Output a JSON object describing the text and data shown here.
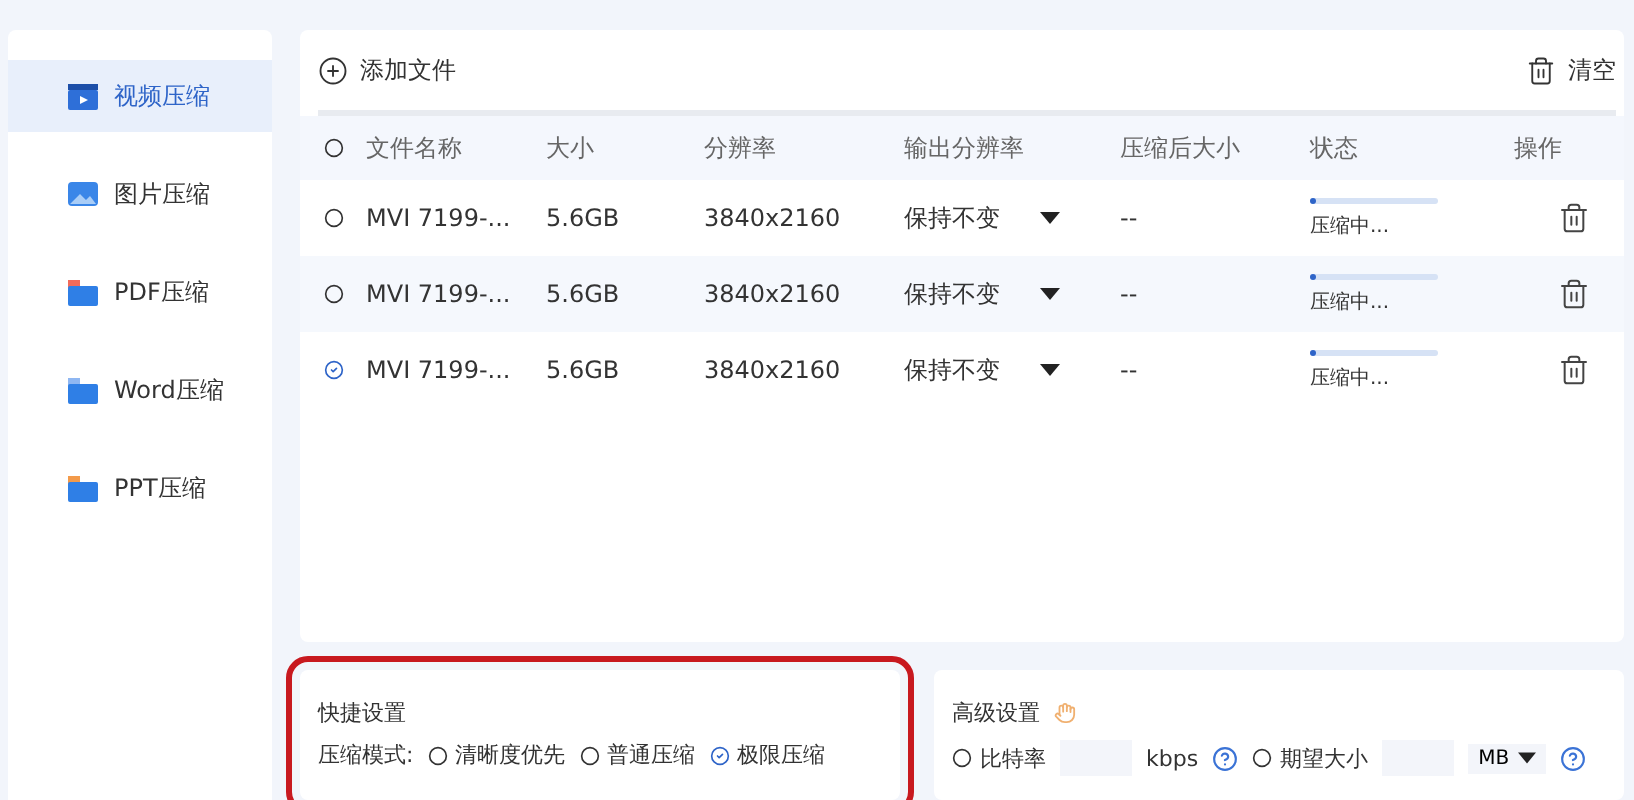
{
  "sidebar": {
    "items": [
      {
        "label": "视频压缩",
        "kind": "video",
        "selected": true
      },
      {
        "label": "图片压缩",
        "kind": "image",
        "selected": false
      },
      {
        "label": "PDF压缩",
        "kind": "pdf",
        "selected": false
      },
      {
        "label": "Word压缩",
        "kind": "word",
        "selected": false
      },
      {
        "label": "PPT压缩",
        "kind": "ppt",
        "selected": false
      }
    ]
  },
  "toolbar": {
    "add": "添加文件",
    "clear": "清空"
  },
  "table": {
    "select_all": false,
    "columns": [
      "文件名称",
      "大小",
      "分辨率",
      "输出分辨率",
      "压缩后大小",
      "状态",
      "操作"
    ],
    "rows": [
      {
        "selected": false,
        "name": "MVI 7199-...",
        "size": "5.6GB",
        "resolution": "3840x2160",
        "output": "保持不变",
        "after": "--",
        "status": "压缩中...",
        "level": 0.02
      },
      {
        "selected": false,
        "name": "MVI 7199-...",
        "size": "5.6GB",
        "resolution": "3840x2160",
        "output": "保持不变",
        "after": "--",
        "status": "压缩中...",
        "level": 0.02
      },
      {
        "selected": true,
        "name": "MVI 7199-...",
        "size": "5.6GB",
        "resolution": "3840x2160",
        "output": "保持不变",
        "after": "--",
        "status": "压缩中...",
        "level": 0.02
      }
    ]
  },
  "quick": {
    "title": "快捷设置",
    "label": "压缩模式:",
    "options": [
      {
        "label": "清晰度优先",
        "selected": false
      },
      {
        "label": "普通压缩",
        "selected": false
      },
      {
        "label": "极限压缩",
        "selected": true
      }
    ]
  },
  "advanced": {
    "title": "高级设置",
    "bitrate": {
      "label": "比特率",
      "selected": false,
      "unit": "kbps"
    },
    "size": {
      "label": "期望大小",
      "selected": false,
      "unit": "MB"
    }
  }
}
